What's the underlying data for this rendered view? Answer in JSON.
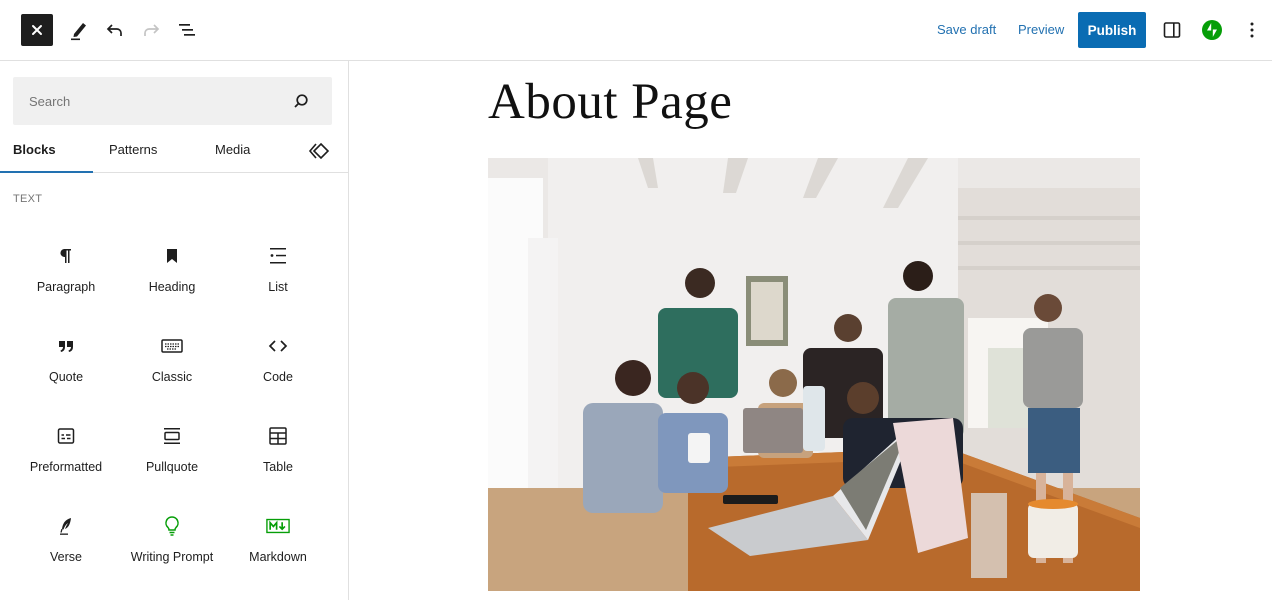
{
  "toolbar": {
    "close_icon": "close-icon",
    "tools_icon": "pencil-icon",
    "undo_icon": "undo-icon",
    "redo_icon": "redo-icon",
    "list_view_icon": "list-view-icon",
    "save_draft_label": "Save draft",
    "preview_label": "Preview",
    "publish_label": "Publish",
    "settings_icon": "sidebar-toggle-icon",
    "jetpack_icon": "jetpack-icon",
    "more_icon": "more-vertical-icon",
    "colors": {
      "primary": "#0a6cb3",
      "link": "#2271b1",
      "jetpack": "#069e08"
    }
  },
  "inserter": {
    "search": {
      "placeholder": "Search",
      "value": ""
    },
    "tabs": [
      {
        "label": "Blocks",
        "active": true
      },
      {
        "label": "Patterns",
        "active": false
      },
      {
        "label": "Media",
        "active": false
      }
    ],
    "tab_extra_icon": "block-directory-icon",
    "section_title": "TEXT",
    "blocks": [
      {
        "label": "Paragraph",
        "icon": "paragraph-icon"
      },
      {
        "label": "Heading",
        "icon": "heading-bookmark-icon"
      },
      {
        "label": "List",
        "icon": "list-icon"
      },
      {
        "label": "Quote",
        "icon": "quote-icon"
      },
      {
        "label": "Classic",
        "icon": "keyboard-icon"
      },
      {
        "label": "Code",
        "icon": "code-icon"
      },
      {
        "label": "Preformatted",
        "icon": "preformatted-icon"
      },
      {
        "label": "Pullquote",
        "icon": "pullquote-icon"
      },
      {
        "label": "Table",
        "icon": "table-icon"
      },
      {
        "label": "Verse",
        "icon": "verse-feather-icon"
      },
      {
        "label": "Writing Prompt",
        "icon": "lightbulb-icon"
      },
      {
        "label": "Markdown",
        "icon": "markdown-icon"
      }
    ]
  },
  "editor": {
    "page_title": "About Page",
    "image_alt": "Group of people gathered around laptops at a wooden table"
  }
}
